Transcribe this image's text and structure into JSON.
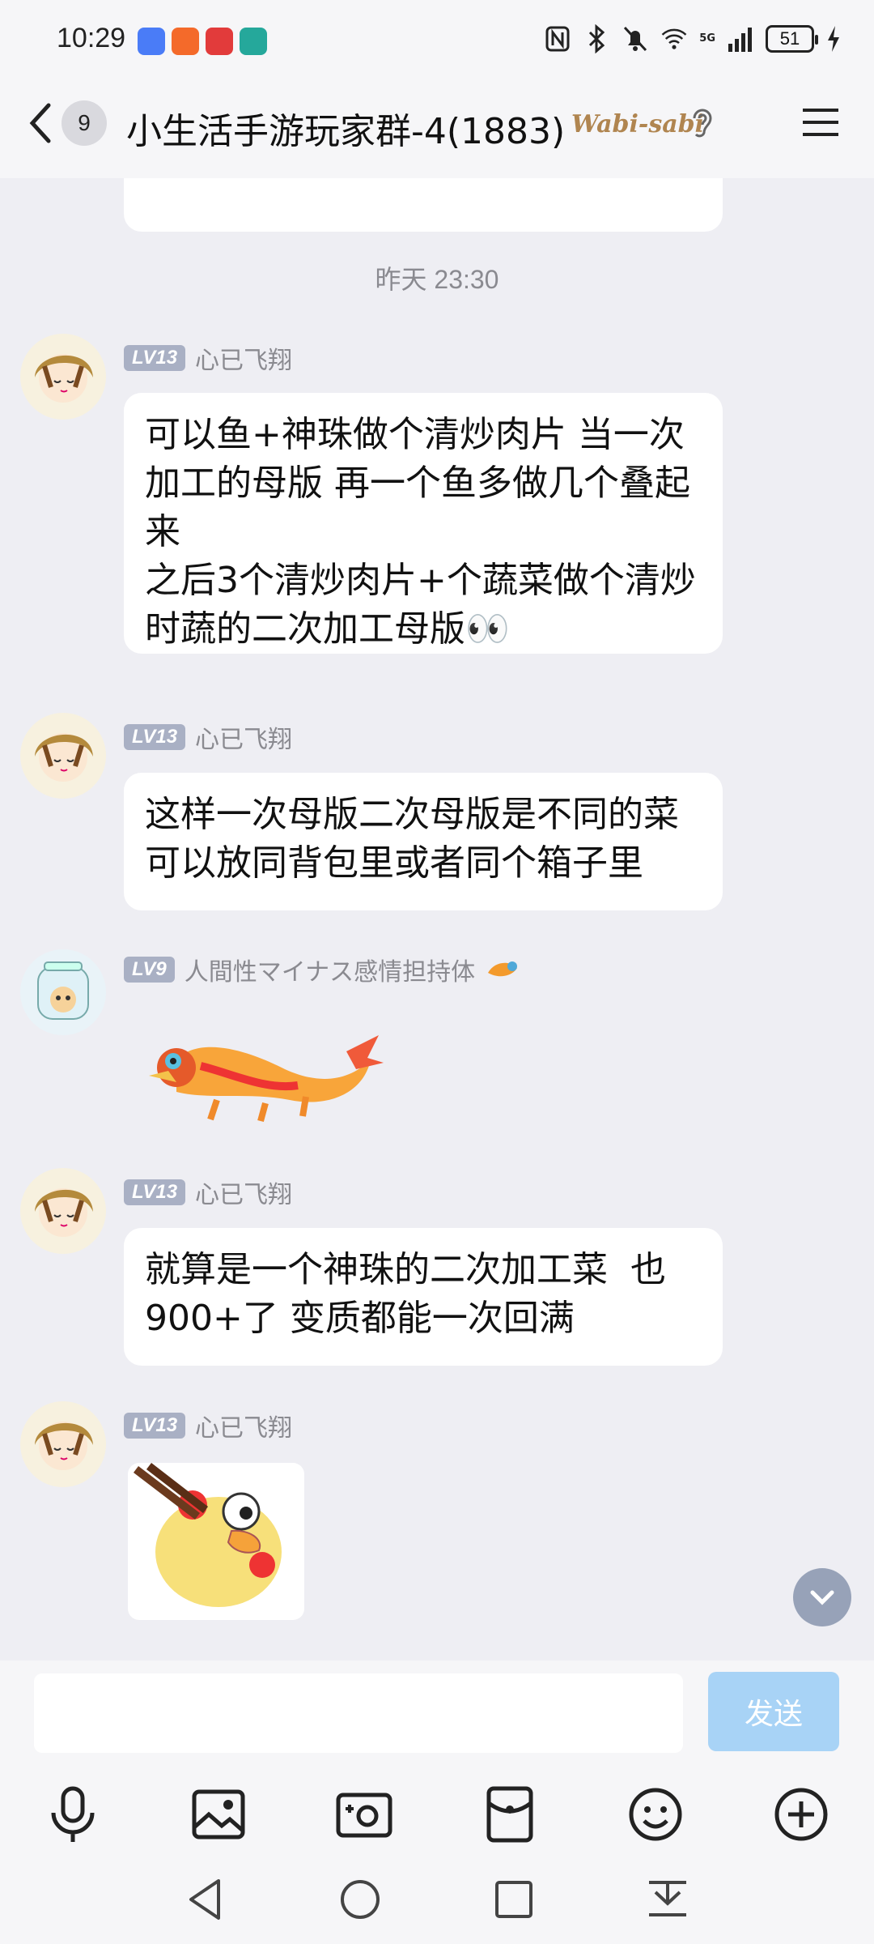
{
  "status_bar": {
    "time": "10:29",
    "network": "5G",
    "battery": "51"
  },
  "header": {
    "back_badge": "9",
    "title": "小生活手游玩家群-4(1883)",
    "group_tag": "Wabi-sabi"
  },
  "chat": {
    "timestamp": "昨天 23:30",
    "messages": [
      {
        "level": "LV13",
        "nickname": "心已飞翔",
        "text": "可以鱼+神珠做个清炒肉片 当一次加工的母版 再一个鱼多做几个叠起来\n之后3个清炒肉片+个蔬菜做个清炒时蔬的二次加工母版👀"
      },
      {
        "level": "LV13",
        "nickname": "心已飞翔",
        "text": "这样一次母版二次母版是不同的菜可以放同背包里或者同个箱子里"
      },
      {
        "level": "LV9",
        "nickname": "人間性マイナス感情担持体",
        "sticker": "dragon-sticker"
      },
      {
        "level": "LV13",
        "nickname": "心已飞翔",
        "text": "就算是一个神珠的二次加工菜  也900+了 变质都能一次回满"
      },
      {
        "level": "LV13",
        "nickname": "心已飞翔",
        "sticker": "duck-sticker"
      }
    ]
  },
  "input": {
    "send_label": "发送",
    "placeholder": ""
  },
  "icons": {
    "toolbar": [
      "microphone-icon",
      "image-icon",
      "camera-icon",
      "red-packet-icon",
      "emoji-icon",
      "plus-icon"
    ],
    "nav": [
      "back-nav-icon",
      "home-nav-icon",
      "recents-nav-icon",
      "notification-nav-icon"
    ]
  },
  "colors": {
    "send_button": "#a8d3f6",
    "level_badge": "#a9b0c4",
    "chat_background": "#eeeef3"
  }
}
